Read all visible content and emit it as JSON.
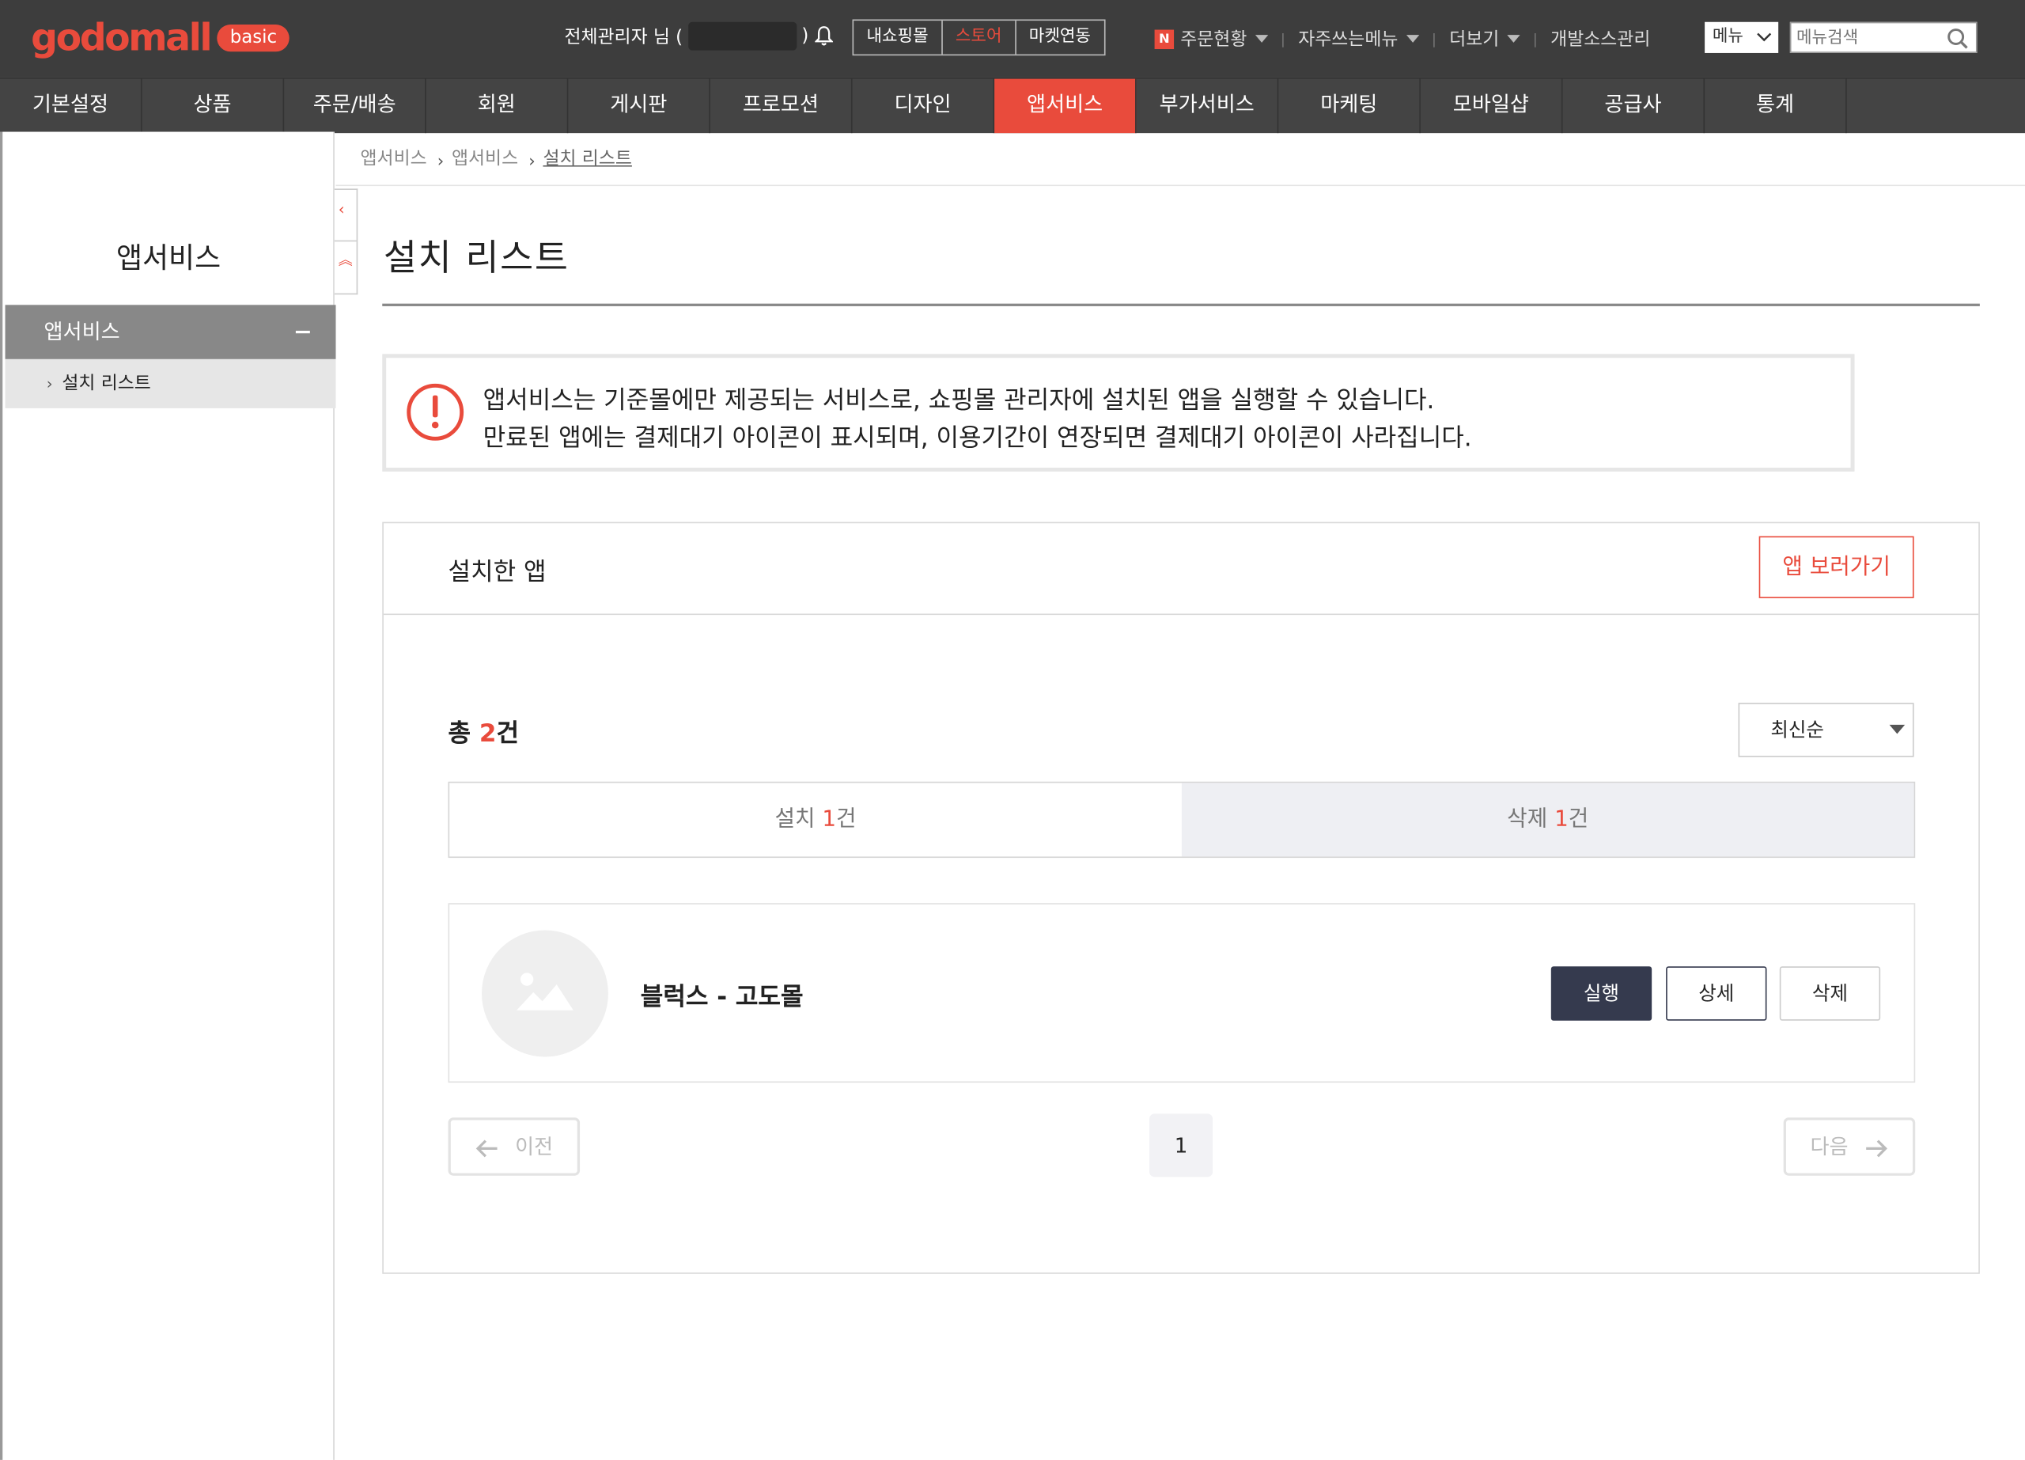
{
  "header": {
    "logo_text": "godomall",
    "logo_badge": "basic",
    "admin_label": "전체관리자 님 (",
    "admin_suffix": ")",
    "shop_buttons": [
      "내쇼핑몰",
      "스토어",
      "마켓연동"
    ],
    "links": [
      "주문현황",
      "자주쓰는메뉴",
      "더보기",
      "개발소스관리"
    ],
    "menu_select": "메뉴",
    "search_placeholder": "메뉴검색"
  },
  "nav": {
    "items": [
      "기본설정",
      "상품",
      "주문/배송",
      "회원",
      "게시판",
      "프로모션",
      "디자인",
      "앱서비스",
      "부가서비스",
      "마케팅",
      "모바일샵",
      "공급사",
      "통계"
    ],
    "active_index": 7
  },
  "sidebar": {
    "title": "앱서비스",
    "group": "앱서비스",
    "items": [
      "설치 리스트"
    ]
  },
  "breadcrumb": [
    "앱서비스",
    "앱서비스",
    "설치 리스트"
  ],
  "page": {
    "title": "설치 리스트",
    "notice_line1": "앱서비스는 기준몰에만 제공되는 서비스로, 쇼핑몰 관리자에 설치된 앱을 실행할 수 있습니다.",
    "notice_line2": "만료된 앱에는 결제대기 아이콘이 표시되며, 이용기간이 연장되면 결제대기 아이콘이 사라집니다."
  },
  "panel": {
    "title": "설치한 앱",
    "app_view_button": "앱 보러가기",
    "total_prefix": "총 ",
    "total_count": "2",
    "total_suffix": "건",
    "sort": "최신순",
    "tabs": [
      {
        "label": "설치 ",
        "count": "1",
        "suffix": "건"
      },
      {
        "label": "삭제 ",
        "count": "1",
        "suffix": "건"
      }
    ],
    "apps": [
      {
        "name": "블럭스 - 고도몰",
        "run": "실행",
        "detail": "상세",
        "delete": "삭제"
      }
    ],
    "pager": {
      "prev": "이전",
      "page": "1",
      "next": "다음"
    }
  },
  "colors": {
    "accent": "#e94b3c",
    "dark_button": "#353a4e",
    "topbar": "#3d3d3d",
    "nav": "#444444"
  }
}
